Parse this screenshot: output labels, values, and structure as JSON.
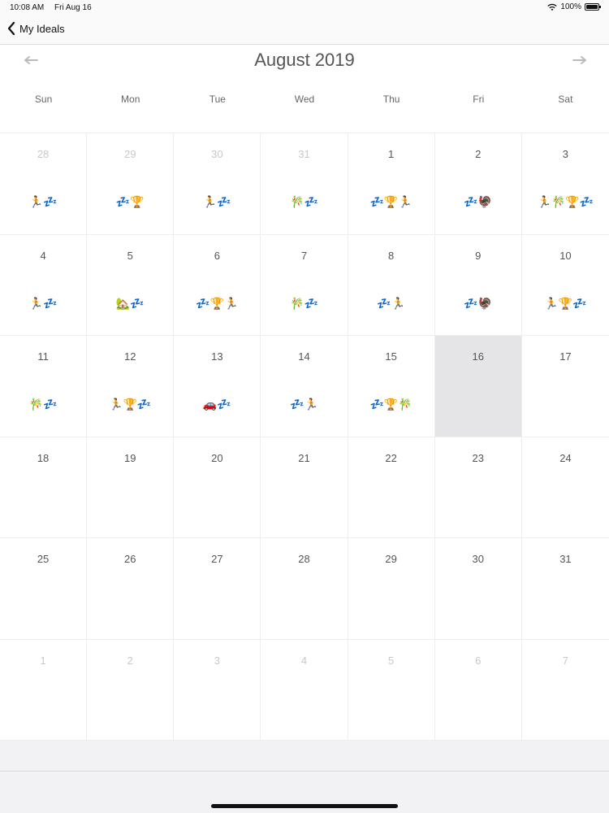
{
  "status_bar": {
    "time": "10:08 AM",
    "date": "Fri Aug 16",
    "battery": "100%"
  },
  "nav": {
    "back_label": "My Ideals"
  },
  "calendar": {
    "title": "August 2019",
    "weekdays": [
      "Sun",
      "Mon",
      "Tue",
      "Wed",
      "Thu",
      "Fri",
      "Sat"
    ],
    "selected_day": "16",
    "days": [
      {
        "num": "28",
        "faded": true,
        "emojis": "🏃💤"
      },
      {
        "num": "29",
        "faded": true,
        "emojis": "💤🏆"
      },
      {
        "num": "30",
        "faded": true,
        "emojis": "🏃💤"
      },
      {
        "num": "31",
        "faded": true,
        "emojis": "🎋💤"
      },
      {
        "num": "1",
        "faded": false,
        "emojis": "💤🏆🏃"
      },
      {
        "num": "2",
        "faded": false,
        "emojis": "💤🦃"
      },
      {
        "num": "3",
        "faded": false,
        "emojis": "🏃🎋🏆💤"
      },
      {
        "num": "4",
        "faded": false,
        "emojis": "🏃💤"
      },
      {
        "num": "5",
        "faded": false,
        "emojis": "🏡💤"
      },
      {
        "num": "6",
        "faded": false,
        "emojis": "💤🏆🏃"
      },
      {
        "num": "7",
        "faded": false,
        "emojis": "🎋💤"
      },
      {
        "num": "8",
        "faded": false,
        "emojis": "💤🏃"
      },
      {
        "num": "9",
        "faded": false,
        "emojis": "💤🦃"
      },
      {
        "num": "10",
        "faded": false,
        "emojis": "🏃🏆💤"
      },
      {
        "num": "11",
        "faded": false,
        "emojis": "🎋💤"
      },
      {
        "num": "12",
        "faded": false,
        "emojis": "🏃🏆💤"
      },
      {
        "num": "13",
        "faded": false,
        "emojis": "🚗💤"
      },
      {
        "num": "14",
        "faded": false,
        "emojis": "💤🏃"
      },
      {
        "num": "15",
        "faded": false,
        "emojis": "💤🏆🎋"
      },
      {
        "num": "16",
        "faded": false,
        "emojis": ""
      },
      {
        "num": "17",
        "faded": false,
        "emojis": ""
      },
      {
        "num": "18",
        "faded": false,
        "emojis": ""
      },
      {
        "num": "19",
        "faded": false,
        "emojis": ""
      },
      {
        "num": "20",
        "faded": false,
        "emojis": ""
      },
      {
        "num": "21",
        "faded": false,
        "emojis": ""
      },
      {
        "num": "22",
        "faded": false,
        "emojis": ""
      },
      {
        "num": "23",
        "faded": false,
        "emojis": ""
      },
      {
        "num": "24",
        "faded": false,
        "emojis": ""
      },
      {
        "num": "25",
        "faded": false,
        "emojis": ""
      },
      {
        "num": "26",
        "faded": false,
        "emojis": ""
      },
      {
        "num": "27",
        "faded": false,
        "emojis": ""
      },
      {
        "num": "28",
        "faded": false,
        "emojis": ""
      },
      {
        "num": "29",
        "faded": false,
        "emojis": ""
      },
      {
        "num": "30",
        "faded": false,
        "emojis": ""
      },
      {
        "num": "31",
        "faded": false,
        "emojis": ""
      },
      {
        "num": "1",
        "faded": true,
        "emojis": ""
      },
      {
        "num": "2",
        "faded": true,
        "emojis": ""
      },
      {
        "num": "3",
        "faded": true,
        "emojis": ""
      },
      {
        "num": "4",
        "faded": true,
        "emojis": ""
      },
      {
        "num": "5",
        "faded": true,
        "emojis": ""
      },
      {
        "num": "6",
        "faded": true,
        "emojis": ""
      },
      {
        "num": "7",
        "faded": true,
        "emojis": ""
      }
    ]
  },
  "icons": {
    "back": "chevron-left-icon",
    "prev": "arrow-left-icon",
    "next": "arrow-right-icon",
    "wifi": "wifi-icon",
    "battery": "battery-icon"
  },
  "colors": {
    "selected_bg": "#e5e5e7",
    "faded_text": "#c8c8c8",
    "arrow": "#bbbbbb"
  }
}
